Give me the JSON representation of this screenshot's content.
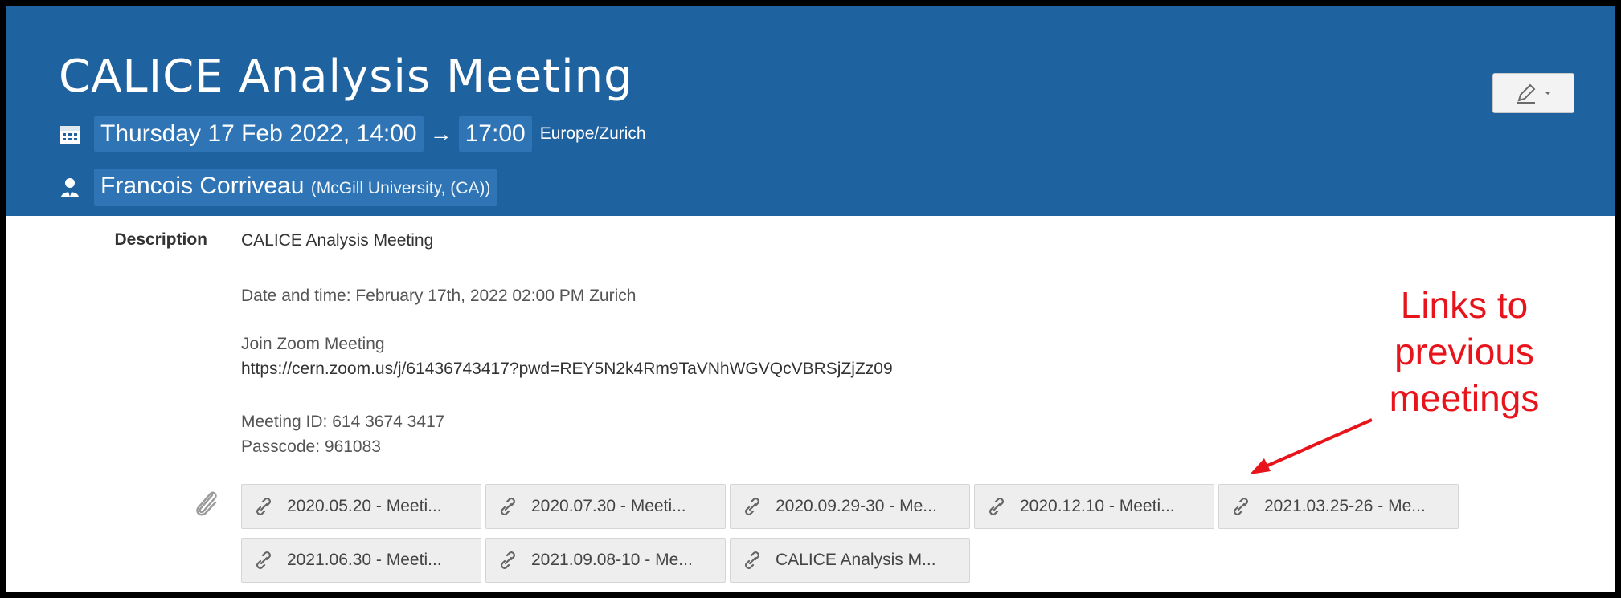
{
  "event": {
    "title": "CALICE Analysis Meeting",
    "start": "Thursday 17 Feb 2022, 14:00",
    "arrow": "→",
    "end": "17:00",
    "timezone": "Europe/Zurich",
    "chair_name": "Francois Corriveau",
    "chair_affiliation": "(McGill University, (CA))"
  },
  "description": {
    "label": "Description",
    "line1": "CALICE Analysis Meeting",
    "line2": "Date and time: February 17th, 2022 02:00 PM Zurich",
    "line3": "Join Zoom Meeting",
    "line4": "https://cern.zoom.us/j/61436743417?pwd=REY5N2k4Rm9TaVNhWGVQcVBRSjZjZz09",
    "line5": "Meeting ID: 614 3674 3417",
    "line6": "Passcode: 961083"
  },
  "attachments": [
    {
      "label": "2020.05.20 - Meeti..."
    },
    {
      "label": "2020.07.30 - Meeti..."
    },
    {
      "label": "2020.09.29-30 - Me..."
    },
    {
      "label": "2020.12.10 - Meeti..."
    },
    {
      "label": "2021.03.25-26 - Me..."
    },
    {
      "label": "2021.06.30 - Meeti..."
    },
    {
      "label": "2021.09.08-10 - Me..."
    },
    {
      "label": "CALICE Analysis M..."
    }
  ],
  "annotation": {
    "line1": "Links to",
    "line2": "previous",
    "line3": "meetings"
  },
  "colors": {
    "header": "#1f62a0",
    "highlight": "#2f74b5",
    "annotation": "#e8141c"
  },
  "icons": {
    "date": "calendar-icon",
    "chair": "user-icon",
    "attachments": "paperclip-icon",
    "link": "link-icon",
    "edit": "pencil-icon"
  }
}
